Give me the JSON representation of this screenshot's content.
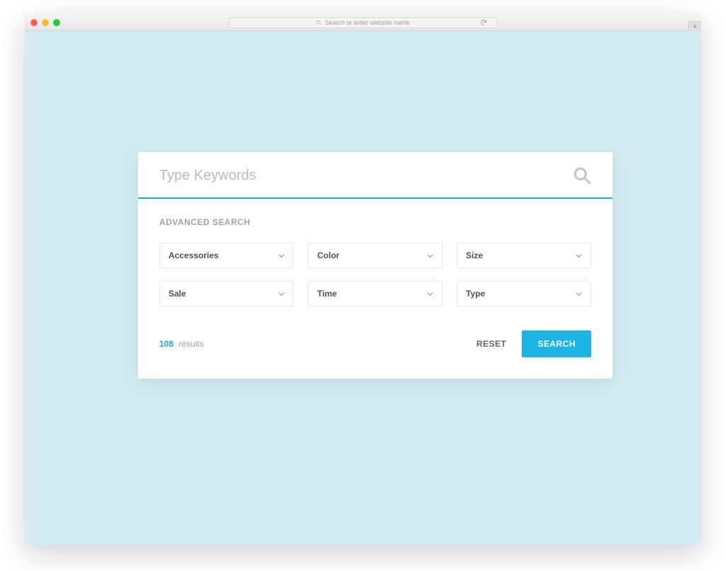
{
  "browser": {
    "address_placeholder": "Search or enter website name"
  },
  "search": {
    "placeholder": "Type Keywords",
    "value": ""
  },
  "advanced": {
    "title": "ADVANCED SEARCH",
    "filters": {
      "accessories": "Accessories",
      "color": "Color",
      "size": "Size",
      "sale": "Sale",
      "time": "Time",
      "type": "Type"
    }
  },
  "results": {
    "count": "108",
    "label": "results"
  },
  "actions": {
    "reset": "RESET",
    "search": "SEARCH"
  }
}
